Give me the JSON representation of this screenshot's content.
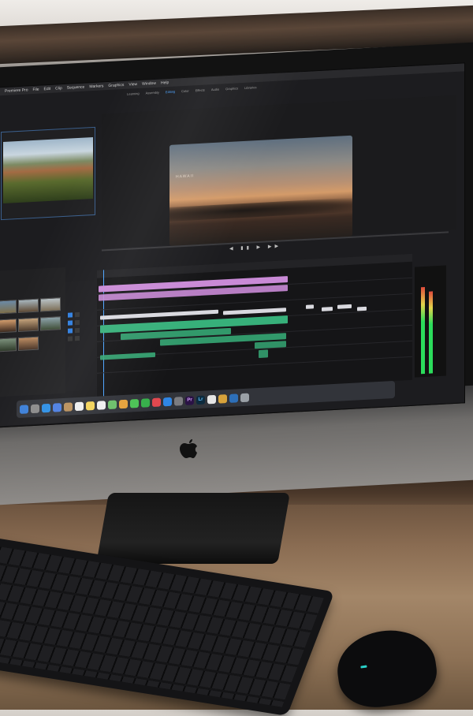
{
  "scene": {
    "app_name": "Premiere Pro",
    "menu": [
      "File",
      "Edit",
      "Clip",
      "Sequence",
      "Markers",
      "Graphics",
      "View",
      "Window",
      "Help"
    ],
    "workspace_tabs": [
      {
        "label": "Learning",
        "active": false
      },
      {
        "label": "Assembly",
        "active": false
      },
      {
        "label": "Editing",
        "active": true
      },
      {
        "label": "Color",
        "active": false
      },
      {
        "label": "Effects",
        "active": false
      },
      {
        "label": "Audio",
        "active": false
      },
      {
        "label": "Graphics",
        "active": false
      },
      {
        "label": "Libraries",
        "active": false
      }
    ],
    "program_overlay_text": "HAWAII",
    "dock_icons": [
      "finder-icon",
      "launchpad-icon",
      "safari-icon",
      "mail-icon",
      "contacts-icon",
      "calendar-icon",
      "notes-icon",
      "reminders-icon",
      "maps-icon",
      "photos-icon",
      "messages-icon",
      "facetime-icon",
      "itunes-icon",
      "appstore-icon",
      "preferences-icon",
      "premiere-icon",
      "lightroom-icon",
      "chrome-icon",
      "folder-icon",
      "downloads-icon",
      "trash-icon"
    ],
    "dock_labels": {
      "premiere": "Pr",
      "lightroom": "Lr"
    },
    "colors": {
      "accent": "#4aa3ff",
      "clip_pink": "#c98ad6",
      "clip_green": "#37b07a",
      "clip_white": "#d9d9df"
    }
  }
}
